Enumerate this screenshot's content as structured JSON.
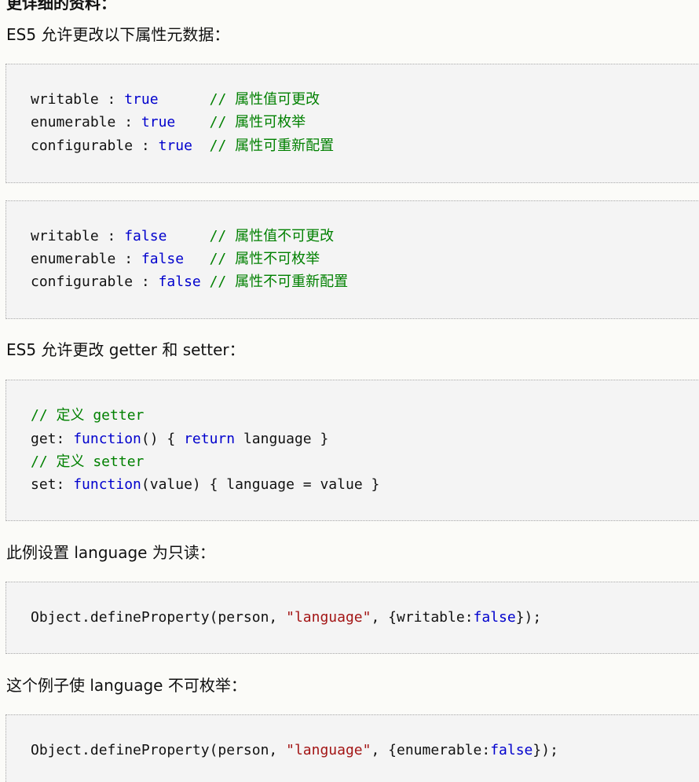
{
  "top_cut_text": "更详细的资料：",
  "p1": "ES5 允许更改以下属性元数据：",
  "code1": {
    "lines": [
      {
        "key": "writable : ",
        "val": "true",
        "pad": "      ",
        "comment": "// 属性值可更改"
      },
      {
        "key": "enumerable : ",
        "val": "true",
        "pad": "    ",
        "comment": "// 属性可枚举"
      },
      {
        "key": "configurable : ",
        "val": "true",
        "pad": "  ",
        "comment": "// 属性可重新配置"
      }
    ]
  },
  "code2": {
    "lines": [
      {
        "key": "writable : ",
        "val": "false",
        "pad": "     ",
        "comment": "// 属性值不可更改"
      },
      {
        "key": "enumerable : ",
        "val": "false",
        "pad": "   ",
        "comment": "// 属性不可枚举"
      },
      {
        "key": "configurable : ",
        "val": "false",
        "pad": " ",
        "comment": "// 属性不可重新配置"
      }
    ]
  },
  "p2": "ES5 允许更改 getter 和 setter：",
  "code3": {
    "c1": "// 定义 getter",
    "l2a": "get: ",
    "l2kw": "function",
    "l2b": "() { ",
    "l2ret": "return",
    "l2c": " language }",
    "c3": "// 定义 setter",
    "l4a": "set: ",
    "l4kw": "function",
    "l4b": "(value) { language = value }"
  },
  "p3": "此例设置 language 为只读：",
  "code4": {
    "a": "Object.defineProperty(person, ",
    "str": "\"language\"",
    "b": ", {writable:",
    "kw": "false",
    "c": "});"
  },
  "p4": "这个例子使 language 不可枚举：",
  "code5": {
    "a": "Object.defineProperty(person, ",
    "str": "\"language\"",
    "b": ", {enumerable:",
    "kw": "false",
    "c": "});"
  },
  "colors": {
    "keyword": "#0000cd",
    "comment": "#008000",
    "string": "#a31515",
    "code_bg": "#f4f4f4",
    "page_bg": "#fbfbf8"
  }
}
